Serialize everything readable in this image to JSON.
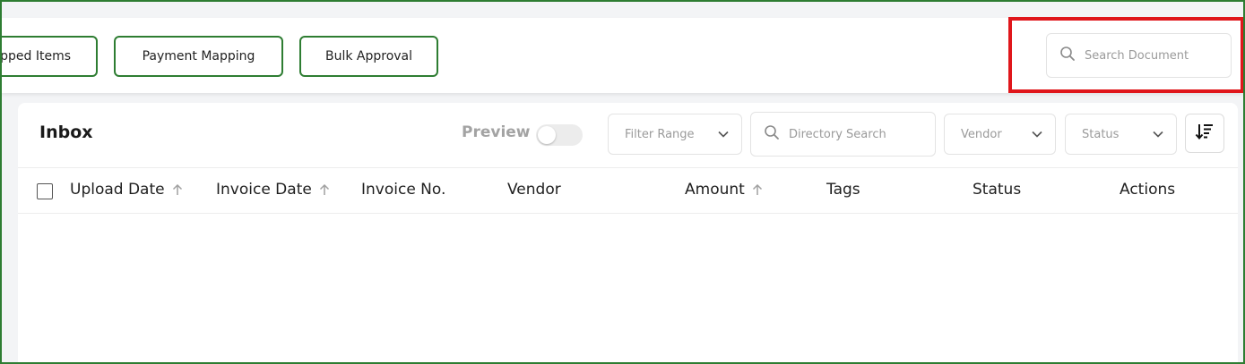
{
  "toolbar": {
    "buttons": [
      {
        "label": "pped Items"
      },
      {
        "label": "Payment Mapping"
      },
      {
        "label": "Bulk Approval"
      }
    ],
    "search_document": {
      "placeholder": "Search Document"
    }
  },
  "inbox": {
    "title": "Inbox",
    "preview_label": "Preview",
    "filter_range": "Filter Range",
    "directory_search": {
      "placeholder": "Directory Search"
    },
    "vendor_select": "Vendor",
    "status_select": "Status"
  },
  "table": {
    "columns": [
      {
        "label": "Upload Date",
        "sortable": true
      },
      {
        "label": "Invoice Date",
        "sortable": true
      },
      {
        "label": "Invoice No.",
        "sortable": false
      },
      {
        "label": "Vendor",
        "sortable": false
      },
      {
        "label": "Amount",
        "sortable": true
      },
      {
        "label": "Tags",
        "sortable": false
      },
      {
        "label": "Status",
        "sortable": false
      },
      {
        "label": "Actions",
        "sortable": false
      }
    ],
    "rows": []
  },
  "colors": {
    "accent_green": "#2e7d32",
    "highlight_red": "#e0161b"
  }
}
